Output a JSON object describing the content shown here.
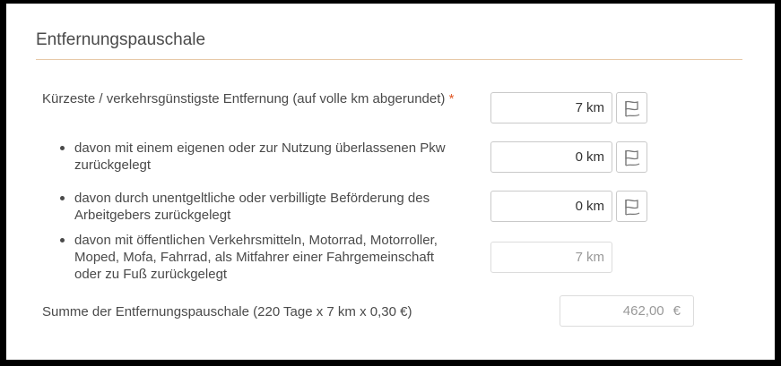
{
  "section": {
    "title": "Entfernungspauschale"
  },
  "rows": [
    {
      "label": "Kürzeste / verkehrsgünstigste Entfernung (auf volle km abgerundet)",
      "required_marker": "*",
      "value": "7",
      "unit": "km",
      "icon": "flag-icon"
    },
    {
      "label": "davon mit einem eigenen oder zur Nutzung überlassenen Pkw zurückgelegt",
      "value": "0",
      "unit": "km",
      "icon": "flag-icon"
    },
    {
      "label": "davon durch unentgeltliche oder verbilligte Beförderung des Arbeitgebers zurückgelegt",
      "value": "0",
      "unit": "km",
      "icon": "flag-icon"
    },
    {
      "label": "davon mit öffentlichen Verkehrsmitteln, Motorrad, Motorroller, Moped, Mofa, Fahrrad, als Mitfahrer einer Fahrgemeinschaft oder zu Fuß zurückgelegt",
      "value": "7",
      "unit": "km"
    }
  ],
  "summary": {
    "label": "Summe der Entfernungspauschale (220 Tage x 7 km x 0,30 €)",
    "value": "462,00",
    "currency": "€"
  },
  "colors": {
    "divider": "#e7c9a8",
    "required": "#e05a28",
    "text": "#4a4a4a"
  }
}
